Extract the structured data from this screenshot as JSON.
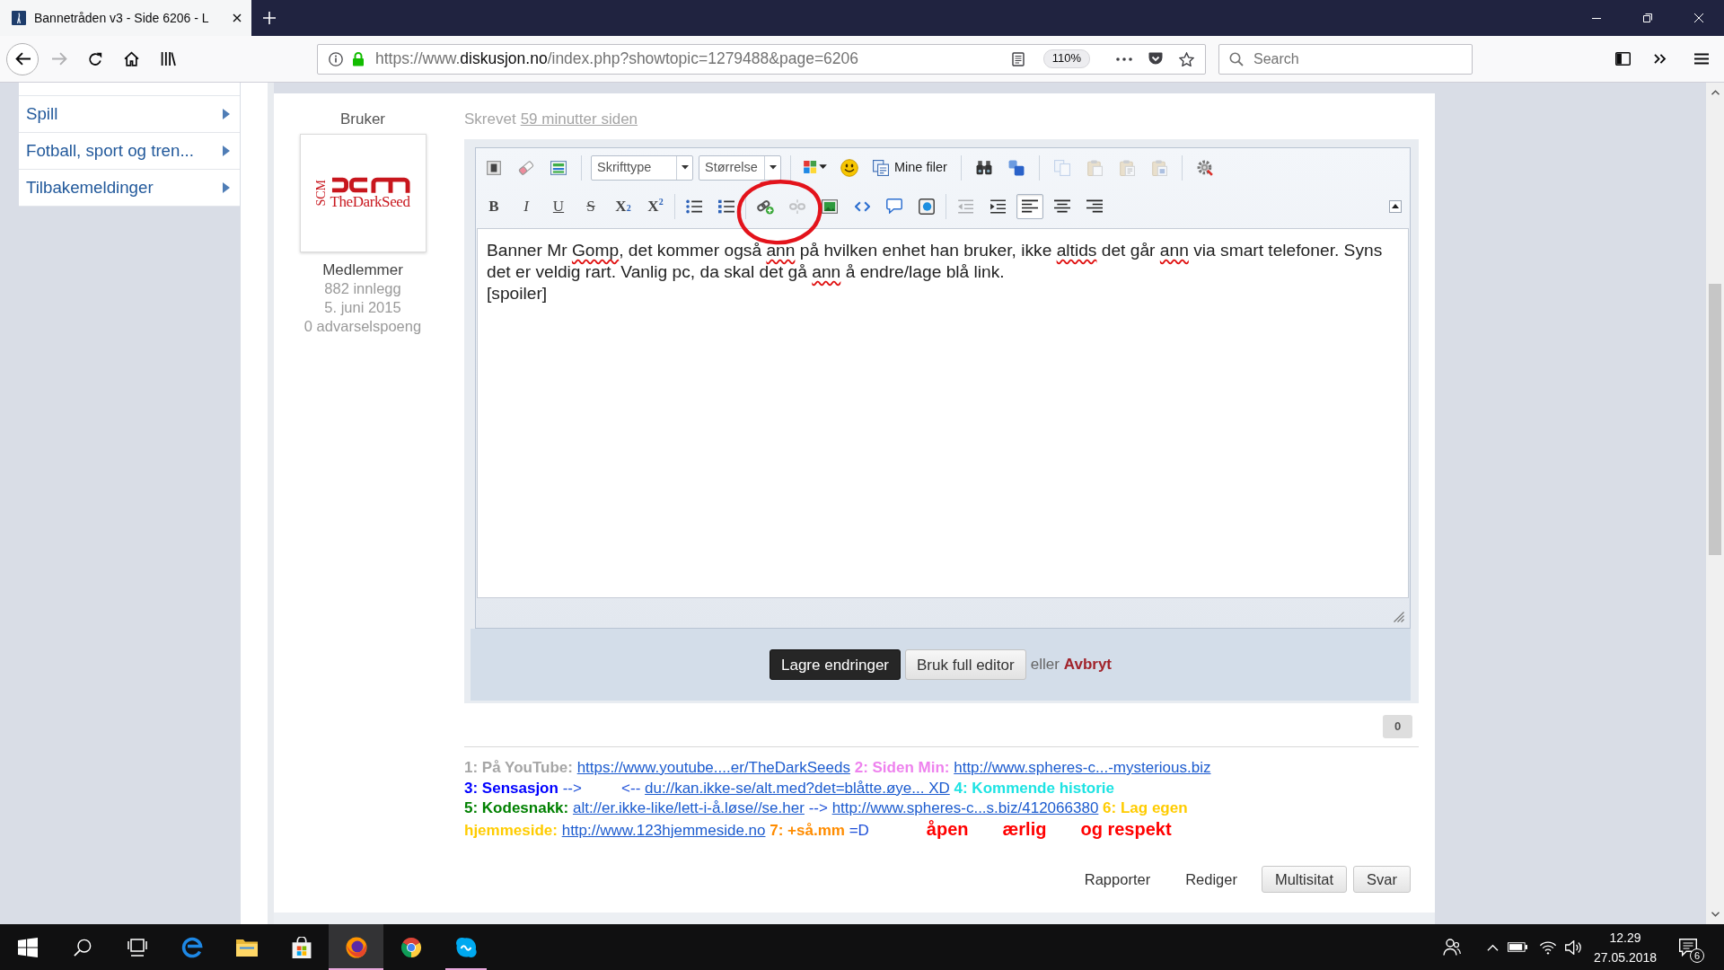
{
  "browser": {
    "tab": {
      "title": "Bannetråden v3 - Side 6206 - L",
      "selected": true
    },
    "nav_buttons": [
      {
        "kind": "back",
        "disabled": false
      },
      {
        "kind": "forward",
        "disabled": true
      },
      {
        "kind": "reload",
        "disabled": false
      },
      {
        "kind": "home",
        "disabled": false
      },
      {
        "kind": "library",
        "disabled": false
      }
    ],
    "url": {
      "scheme": "https://www.",
      "domain": "diskusjon.no",
      "path": "/index.php?showtopic=1279488&page=6206"
    },
    "zoom": "110%",
    "search": {
      "placeholder": "Search"
    }
  },
  "sidebar": {
    "items": [
      {
        "label": "Spill"
      },
      {
        "label": "Fotball, sport og tren..."
      },
      {
        "label": "Tilbakemeldinger"
      }
    ]
  },
  "post": {
    "author": {
      "heading": "Bruker",
      "avatar": {
        "side_text": "SCM",
        "name_text": "TheDarkSeed"
      },
      "group": "Medlemmer",
      "stats": [
        "882 innlegg",
        "5. juni 2015",
        "0 advarselspoeng"
      ]
    },
    "posted": {
      "prefix": "Skrevet",
      "time": "59 minutter siden"
    },
    "editor": {
      "toolbar": [
        [
          [
            {
              "kind": "frame",
              "disabled": false
            },
            {
              "kind": "eraser",
              "disabled": false
            },
            {
              "kind": "layout",
              "disabled": false
            }
          ],
          [
            {
              "kind": "select",
              "label": "Skrifttype",
              "disabled": false
            },
            {
              "kind": "select",
              "label": "Størrelse",
              "disabled": false
            }
          ],
          [
            {
              "kind": "text_color",
              "disabled": false
            },
            {
              "kind": "smiley",
              "disabled": false
            },
            {
              "kind": "files",
              "label": "Mine filer",
              "disabled": false
            }
          ],
          [
            {
              "kind": "binoculars",
              "disabled": false
            },
            {
              "kind": "replace",
              "disabled": false
            }
          ],
          [
            {
              "kind": "copy",
              "disabled": true
            },
            {
              "kind": "paste",
              "disabled": true
            },
            {
              "kind": "paste_text",
              "disabled": true
            },
            {
              "kind": "paste_word",
              "disabled": true
            }
          ],
          [
            {
              "kind": "gear",
              "disabled": false
            }
          ]
        ],
        [
          [
            {
              "kind": "bold",
              "label": "B",
              "disabled": false,
              "pressed": false
            },
            {
              "kind": "italic",
              "label": "I",
              "disabled": false,
              "pressed": false
            },
            {
              "kind": "underline",
              "label": "U",
              "disabled": false,
              "pressed": false
            },
            {
              "kind": "strike",
              "label": "S",
              "disabled": false,
              "pressed": false
            },
            {
              "kind": "subscript",
              "label": "X$_{2}$",
              "disabled": false,
              "pressed": false
            },
            {
              "kind": "superscript",
              "label": "X$^{2}$",
              "disabled": false,
              "pressed": false
            }
          ],
          [
            {
              "kind": "bullet_list",
              "disabled": false,
              "pressed": false
            },
            {
              "kind": "numbered_list",
              "disabled": false,
              "pressed": false
            }
          ],
          [
            {
              "kind": "link",
              "disabled": false,
              "pressed": false
            },
            {
              "kind": "unlink",
              "disabled": true,
              "pressed": false
            },
            {
              "kind": "image",
              "disabled": false,
              "pressed": false
            },
            {
              "kind": "code",
              "disabled": false,
              "pressed": false
            },
            {
              "kind": "bubble",
              "disabled": false,
              "pressed": false
            },
            {
              "kind": "framed",
              "disabled": false,
              "pressed": false
            }
          ],
          [
            {
              "kind": "outdent",
              "disabled": true,
              "pressed": false
            },
            {
              "kind": "indent",
              "disabled": false,
              "pressed": false
            },
            {
              "kind": "align_left",
              "disabled": false,
              "pressed": true
            },
            {
              "kind": "align_center",
              "disabled": false,
              "pressed": false
            },
            {
              "kind": "align_right",
              "disabled": false,
              "pressed": false
            }
          ]
        ]
      ],
      "content": [
        [
          {
            "text": "Banner Mr ",
            "misspelled": false
          },
          {
            "text": "Gomp",
            "misspelled": true
          },
          {
            "text": ", det kommer også ",
            "misspelled": false
          },
          {
            "text": "ann",
            "misspelled": true
          },
          {
            "text": " på hvilken enhet han bruker, ikke ",
            "misspelled": false
          },
          {
            "text": "altids",
            "misspelled": true
          },
          {
            "text": " det går ",
            "misspelled": false
          },
          {
            "text": "ann",
            "misspelled": true
          },
          {
            "text": " via smart telefoner. Syns det er veldig rart. Vanlig pc, da skal det gå ",
            "misspelled": false
          },
          {
            "text": "ann",
            "misspelled": true
          },
          {
            "text": " å endre/lage blå link.",
            "misspelled": false
          }
        ],
        [
          {
            "text": "[spoiler]",
            "misspelled": false
          }
        ]
      ],
      "buttons": [
        {
          "label": "Lagre endringer",
          "kind": "primary"
        },
        {
          "label": "Bruk full editor",
          "kind": "secondary"
        }
      ],
      "or_text": "eller",
      "cancel": "Avbryt"
    },
    "reputation": "0",
    "signature": [
      [
        {
          "kind": "label",
          "text": "1: På YouTube:",
          "color": "#a6a6a6"
        },
        {
          "kind": "link",
          "text": "https://www.youtube....er/TheDarkSeeds"
        },
        {
          "kind": "label",
          "text": "2: Siden Min:",
          "color": "#ee82ee"
        },
        {
          "kind": "link",
          "text": "http://www.spheres-c...-mysterious.biz"
        }
      ],
      [
        {
          "kind": "label",
          "text": "3: Sensasjon",
          "color": "#0000ff"
        },
        {
          "kind": "plain",
          "text": "-->"
        },
        {
          "kind": "plain",
          "text": "<--",
          "spaced": true
        },
        {
          "kind": "link",
          "text": "du://kan.ikke-se/alt.med?det=blåtte.øye... XD"
        },
        {
          "kind": "label",
          "text": "4: Kommende historie",
          "color": "#1ee3e3"
        }
      ],
      [
        {
          "kind": "label",
          "text": "5: Kodesnakk:",
          "color": "#008000"
        },
        {
          "kind": "link",
          "text": "alt://er.ikke-like/lett-i-å.løse//se.her"
        },
        {
          "kind": "plain",
          "text": "-->"
        },
        {
          "kind": "link",
          "text": "http://www.spheres-c...s.biz/412066380"
        },
        {
          "kind": "label",
          "text": "6: Lag egen",
          "color": "#ffcc00"
        }
      ],
      [
        {
          "kind": "label",
          "text": "hjemmeside:",
          "color": "#ffcc00"
        },
        {
          "kind": "link",
          "text": "http://www.123hjemmeside.no"
        },
        {
          "kind": "label",
          "text": "7: +så.mm",
          "color": "#ff8c00"
        },
        {
          "kind": "plain",
          "text": "=D"
        },
        {
          "kind": "motto",
          "text": "åpen",
          "spaced": true
        },
        {
          "kind": "motto",
          "text": "ærlig",
          "spaced": true
        },
        {
          "kind": "motto",
          "text": "og respekt",
          "spaced": true
        }
      ]
    ],
    "actions": [
      {
        "label": "Rapporter",
        "kind": "link"
      },
      {
        "label": "Rediger",
        "kind": "link"
      },
      {
        "label": "Multisitat",
        "kind": "button"
      },
      {
        "label": "Svar",
        "kind": "button"
      }
    ]
  },
  "taskbar": {
    "apps": [
      {
        "kind": "e_logo",
        "open": false,
        "selected": false
      },
      {
        "kind": "folder",
        "open": false,
        "selected": false
      },
      {
        "kind": "bag",
        "open": false,
        "selected": false
      },
      {
        "kind": "fox_globe",
        "open": true,
        "selected": true
      },
      {
        "kind": "segmented_circle",
        "open": false,
        "selected": false
      },
      {
        "kind": "chat_badge",
        "open": true,
        "selected": false
      }
    ],
    "clock": {
      "time": "12.29",
      "date": "27.05.2018"
    },
    "notifications": "6"
  }
}
